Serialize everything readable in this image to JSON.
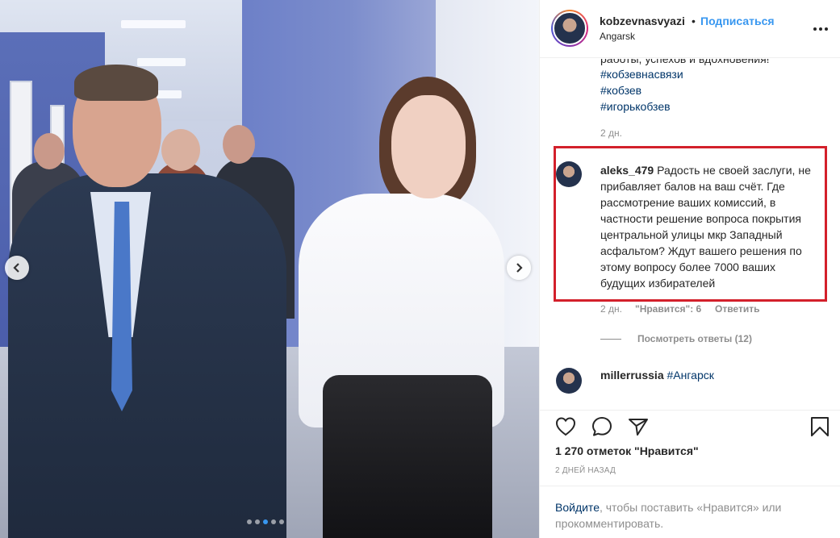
{
  "post": {
    "username": "kobzevnasvyazi",
    "separator": "•",
    "follow_label": "Подписаться",
    "location": "Angarsk",
    "more_icon": "more-horizontal-icon"
  },
  "carousel": {
    "prev_icon": "chevron-left-icon",
    "next_icon": "chevron-right-icon",
    "slides_count": 5,
    "active_slide": 3
  },
  "caption": {
    "cut_line": "работы, успехов и вдохновения!",
    "hashtags": [
      "#кобзевнасвязи",
      "#кобзев",
      "#игорькобзев"
    ],
    "time": "2 дн."
  },
  "highlighted_comment": {
    "username": "aleks_479",
    "text": "Радость не своей заслуги, не прибавляет балов на ваш счёт. Где рассмотрение ваших комиссий, в частности решение вопроса покрытия центральной улицы мкр Западный асфальтом? Ждут вашего решения по этому вопросу более 7000 ваших будущих избирателей",
    "time": "2 дн.",
    "likes": "\"Нравится\": 6",
    "reply_label": "Ответить",
    "view_replies": "Посмотреть ответы (12)",
    "highlight_color": "#d3202b"
  },
  "second_comment": {
    "username": "millerrussia",
    "hashtag": "#Ангарск"
  },
  "actions": {
    "like_icon": "heart-icon",
    "comment_icon": "comment-icon",
    "share_icon": "share-icon",
    "save_icon": "bookmark-icon"
  },
  "likes_text": "1 270 отметок \"Нравится\"",
  "date_text": "2 дней назад",
  "login": {
    "link": "Войдите",
    "text": ", чтобы поставить «Нравится» или прокомментировать."
  },
  "colors": {
    "link_blue": "#3897f0",
    "hashtag_blue": "#003569",
    "muted": "#8e8e8e",
    "text": "#262626"
  }
}
